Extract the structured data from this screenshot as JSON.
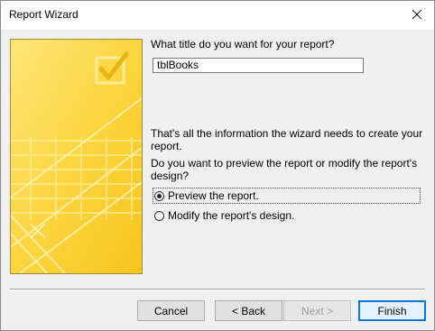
{
  "window": {
    "title": "Report Wizard"
  },
  "icons": {
    "close": "close-icon",
    "art": "report-wizard-art"
  },
  "prompt_title": "What title do you want for your report?",
  "title_value": "tblBooks",
  "info_line1": "That's all the information the wizard needs to create your",
  "info_line2": "report.",
  "question_line1": "Do you want to preview the report or modify the report's",
  "question_line2": "design?",
  "options": {
    "preview": {
      "label": "Preview the report.",
      "checked": true
    },
    "modify": {
      "label": "Modify the report's design.",
      "checked": false
    }
  },
  "buttons": {
    "cancel": "Cancel",
    "back": "< Back",
    "next": "Next >",
    "finish": "Finish"
  },
  "colors": {
    "art_yellow": "#fcd53f",
    "art_light": "#fff3a6",
    "default_button_border": "#0078d7"
  }
}
